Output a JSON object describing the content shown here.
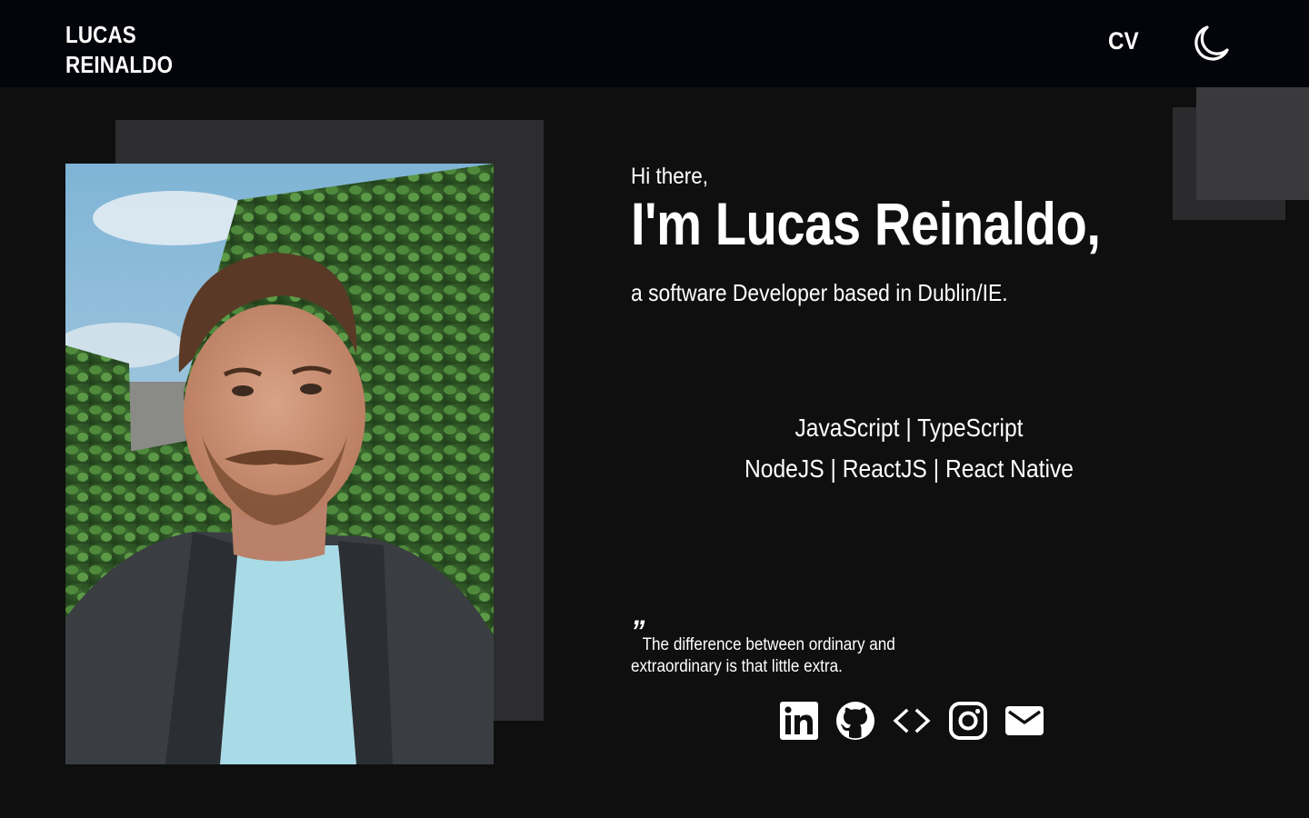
{
  "header": {
    "logo_line1": "LUCAS",
    "logo_line2": "REINALDO",
    "cv_label": "CV",
    "theme_icon": "moon-icon"
  },
  "intro": {
    "greeting": "Hi there,",
    "name": "I'm Lucas Reinaldo,",
    "tagline": "a software Developer based in Dublin/IE."
  },
  "skills": {
    "line1": "JavaScript | TypeScript",
    "line2": "NodeJS | ReactJS | React Native"
  },
  "quote": {
    "mark": "”",
    "text": "The difference between ordinary and extraordinary is that little extra."
  },
  "socials": [
    {
      "icon": "linkedin-icon"
    },
    {
      "icon": "github-icon"
    },
    {
      "icon": "code-icon"
    },
    {
      "icon": "instagram-icon"
    },
    {
      "icon": "mail-icon"
    }
  ],
  "colors": {
    "header_bg": "#03050b",
    "page_bg": "#0f0f10",
    "text": "#ffffff",
    "deco_dark": "#2b2b2e",
    "deco_light": "#3a3a3d"
  }
}
